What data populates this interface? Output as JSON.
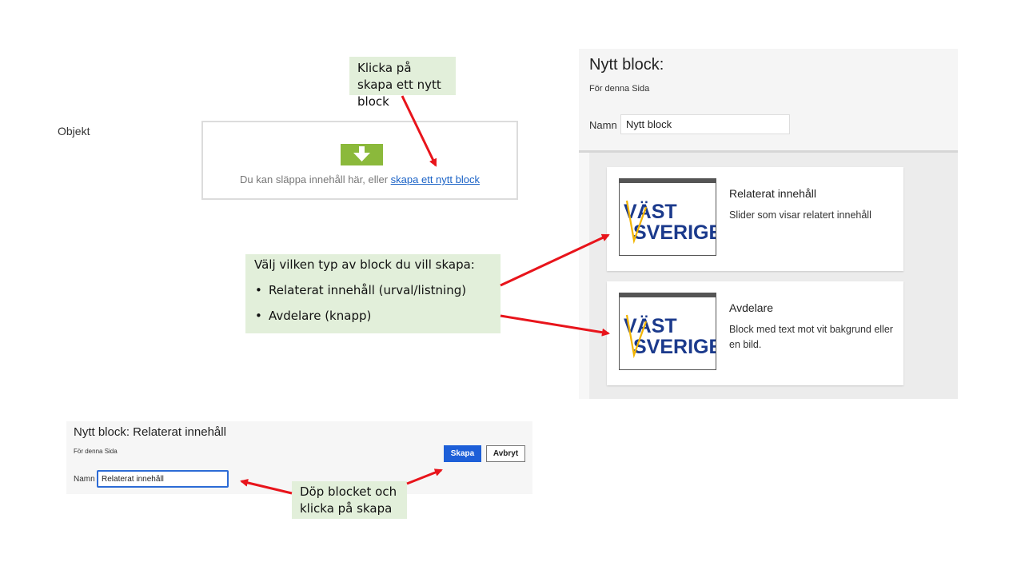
{
  "objekt": {
    "label": "Objekt",
    "drop_zone": {
      "text": "Du kan släppa innehåll här, eller ",
      "link": "skapa ett nytt block",
      "icon": "download-arrow-icon",
      "icon_color": "#8bb93b"
    }
  },
  "callouts": {
    "create": "Klicka på skapa ett nytt block",
    "choose_title": "Välj vilken typ av block du vill skapa:",
    "choose_items": [
      "Relaterat innehåll (urval/listning)",
      "Avdelare (knapp)"
    ],
    "rename": "Döp blocket och klicka på skapa"
  },
  "new_block_dialog": {
    "title": "Nytt block:",
    "subtitle": "För denna Sida",
    "name_label": "Namn",
    "name_value": "Nytt block",
    "blocks": [
      {
        "title": "Relaterat innehåll",
        "description": "Slider som visar relatert innehåll",
        "logo_top": "VÄST",
        "logo_bottom": "SVERIGE"
      },
      {
        "title": "Avdelare",
        "description": "Block med text mot vit bakgrund eller en bild.",
        "logo_top": "VÄST",
        "logo_bottom": "SVERIGE"
      }
    ]
  },
  "named_block_dialog": {
    "title": "Nytt block: Relaterat innehåll",
    "subtitle": "För denna Sida",
    "name_label": "Namn",
    "name_value": "Relaterat innehåll",
    "create_label": "Skapa",
    "cancel_label": "Avbryt"
  },
  "colors": {
    "callout_bg": "#e2efda",
    "arrow": "#e8141b",
    "primary_button": "#1d5fd8",
    "logo_blue": "#1b3a8c",
    "logo_yellow": "#f2b400"
  }
}
